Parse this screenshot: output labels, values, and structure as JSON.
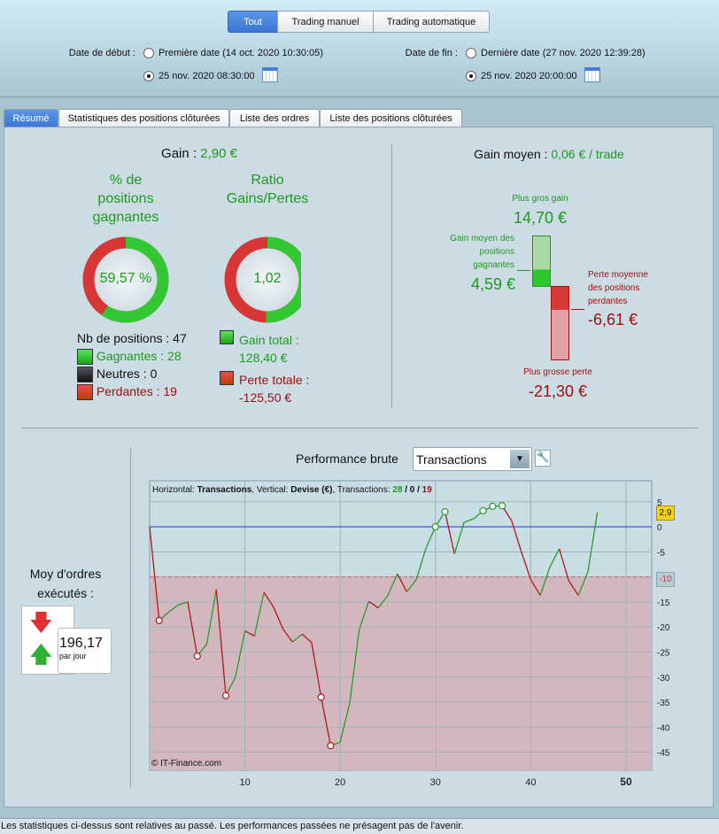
{
  "filters": {
    "buttons": [
      "Tout",
      "Trading manuel",
      "Trading automatique"
    ],
    "selected": "Tout"
  },
  "dates": {
    "start_label": "Date de début :",
    "start_first": "Première date (14 oct. 2020 10:30:05)",
    "start_custom": "25 nov. 2020 08:30:00",
    "end_label": "Date de fin :",
    "end_last": "Dernière date (27 nov. 2020 12:39:28)",
    "end_custom": "25 nov. 2020 20:00:00"
  },
  "tabs": [
    "Résumé",
    "Statistiques des positions clôturées",
    "Liste des ordres",
    "Liste des positions clôturées"
  ],
  "summary": {
    "gain_label": "Gain :",
    "gain_value": "2,90 €",
    "pct_title": "% de positions gagnantes",
    "pct_value": "59,57 %",
    "pct_fraction": 0.5957,
    "ratio_title": "Ratio Gains/Pertes",
    "ratio_value": "1,02",
    "ratio_green_fraction": 0.5057,
    "nb_positions": "Nb de positions : 47",
    "gagnantes": "Gagnantes : 28",
    "neutres": "Neutres : 0",
    "perdantes": "Perdantes : 19",
    "gain_total_label": "Gain total :",
    "gain_total": "128,40 €",
    "perte_totale_label": "Perte totale :",
    "perte_totale": "-125,50 €",
    "gain_moyen_label": "Gain moyen :",
    "gain_moyen": "0,06 € / trade",
    "plus_gros_gain_label": "Plus gros gain",
    "plus_gros_gain": "14,70 €",
    "gain_moyen_pos_label": "Gain moyen des positions gagnantes",
    "gain_moyen_pos": "4,59 €",
    "perte_moyenne_label": "Perte moyenne des positions perdantes",
    "perte_moyenne": "-6,61 €",
    "plus_grosse_perte_label": "Plus grosse perte",
    "plus_grosse_perte": "-21,30 €",
    "moy_ordres_label": "Moy d'ordres exécutés :",
    "moy_ordres": "196,17",
    "par_jour": "par jour"
  },
  "performance": {
    "label": "Performance brute",
    "select_value": "Transactions"
  },
  "chart_data": {
    "type": "line",
    "header": {
      "h_label": "Horizontal:",
      "h_value": "Transactions",
      "v_label": ", Vertical:",
      "v_value": "Devise (€)",
      "t_label": ", Transactions:",
      "wins": "28",
      "neutral": "0",
      "losses": "19"
    },
    "watermark": "© IT-Finance.com",
    "x": [
      0,
      1,
      2,
      3,
      4,
      5,
      6,
      7,
      8,
      9,
      10,
      11,
      12,
      13,
      14,
      15,
      16,
      17,
      18,
      19,
      20,
      21,
      22,
      23,
      24,
      25,
      26,
      27,
      28,
      29,
      30,
      31,
      32,
      33,
      34,
      35,
      36,
      37,
      38,
      39,
      40,
      41,
      42,
      43,
      44,
      45,
      46,
      47
    ],
    "y": [
      0,
      -18.7,
      -17,
      -15.6,
      -15,
      -25.8,
      -23.4,
      -12.5,
      -33.7,
      -30,
      -20.8,
      -21.8,
      -13.1,
      -16,
      -20.4,
      -23,
      -21.4,
      -23.1,
      -34,
      -43.7,
      -43,
      -35.2,
      -20.5,
      -14.9,
      -16.2,
      -13.7,
      -9.4,
      -13,
      -10.5,
      -4.3,
      0,
      3,
      -5.4,
      0.9,
      1.6,
      3.2,
      4.1,
      4.2,
      1.2,
      -4.9,
      -10.5,
      -13.7,
      -8.1,
      -4.4,
      -10.8,
      -13.7,
      -9,
      2.9
    ],
    "marked_points": [
      1,
      5,
      8,
      18,
      19,
      30,
      31,
      35,
      36,
      37
    ],
    "xlim": [
      0,
      52.7
    ],
    "ylim": [
      -48.6,
      9.2
    ],
    "xticks": [
      10,
      20,
      30,
      40,
      50
    ],
    "yticks": [
      5,
      0,
      -5,
      -15,
      -20,
      -25,
      -30,
      -35,
      -40,
      -45
    ],
    "zero_line": 0,
    "threshold": -10,
    "threshold_label": "-10",
    "last_value_label": "2,9",
    "colors": {
      "up": "#2a9a2a",
      "down": "#b01818",
      "zero": "#2233cc",
      "loss_zone": "#d2b8be",
      "bg": "#c9dde5"
    },
    "grid": true
  },
  "footer": "Les statistiques ci-dessus sont relatives au passé. Les performances passées ne présagent pas de l'avenir."
}
